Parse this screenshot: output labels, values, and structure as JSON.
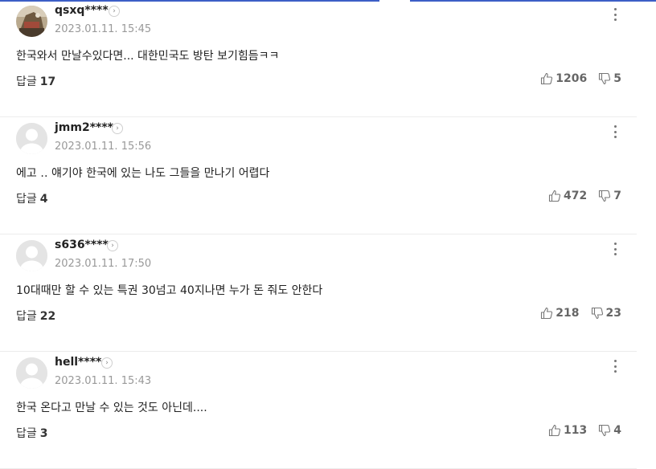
{
  "comments": [
    {
      "username": "qsxq****",
      "date": "2023.01.11. 15:45",
      "text": "한국와서 만날수있다면... 대한민국도 방탄 보기힘듬ㅋㅋ",
      "reply_label": "답글",
      "reply_count": "17",
      "likes": "1206",
      "dislikes": "5",
      "has_photo": true
    },
    {
      "username": "jmm2****",
      "date": "2023.01.11. 15:56",
      "text": "에고 ‥ 얘기야 한국에 있는 나도 그들을 만나기 어렵다",
      "reply_label": "답글",
      "reply_count": "4",
      "likes": "472",
      "dislikes": "7",
      "has_photo": false
    },
    {
      "username": "s636****",
      "date": "2023.01.11. 17:50",
      "text": "10대때만 할 수 있는 특권 30넘고 40지나면 누가 돈 줘도 안한다",
      "reply_label": "답글",
      "reply_count": "22",
      "likes": "218",
      "dislikes": "23",
      "has_photo": false
    },
    {
      "username": "hell****",
      "date": "2023.01.11. 15:43",
      "text": "한국 온다고 만날 수 있는 것도 아닌데....",
      "reply_label": "답글",
      "reply_count": "3",
      "likes": "113",
      "dislikes": "4",
      "has_photo": false
    }
  ],
  "icons": {
    "profile_arrow": "chevron-right-icon",
    "more": "more-vertical-icon",
    "like": "thumbs-up-icon",
    "dislike": "thumbs-down-icon"
  },
  "colors": {
    "accent_line": "#3c5ec6",
    "date": "#999999",
    "count": "#666666"
  }
}
